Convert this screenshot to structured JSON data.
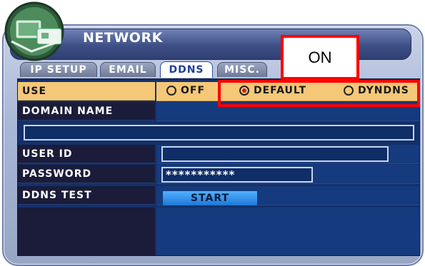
{
  "window": {
    "title": "NETWORK"
  },
  "tabs": [
    {
      "label": "IP SETUP",
      "active": false
    },
    {
      "label": "EMAIL",
      "active": false
    },
    {
      "label": "DDNS",
      "active": true
    },
    {
      "label": "MISC.",
      "active": false
    }
  ],
  "rows": {
    "use": {
      "label": "USE",
      "options": [
        {
          "label": "OFF",
          "selected": false
        },
        {
          "label": "DEFAULT",
          "selected": true
        },
        {
          "label": "DYNDNS",
          "selected": false
        }
      ]
    },
    "domain_name": {
      "label": "DOMAIN NAME",
      "value": ""
    },
    "user_id": {
      "label": "USER ID",
      "value": ""
    },
    "password": {
      "label": "PASSWORD",
      "value": "***********"
    },
    "ddns_test": {
      "label": "DDNS TEST",
      "button": "START"
    }
  },
  "annotation": {
    "text": "ON",
    "color": "#ff0000"
  },
  "colors": {
    "highlight_row": "#f5c877",
    "panel": "#13306b",
    "accent_red": "#ff0000"
  },
  "icons": {
    "logo": "network-server-icon"
  }
}
